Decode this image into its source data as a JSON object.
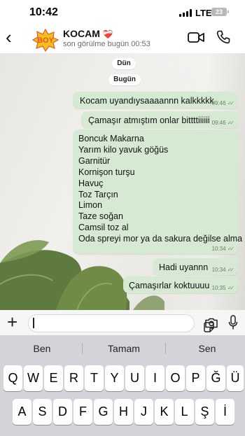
{
  "status_bar": {
    "time": "10:42",
    "network": "LTE",
    "battery": "23"
  },
  "header": {
    "back_icon": "chevron-left-icon",
    "avatar_text": "BOY",
    "contact_name": "KOCAM",
    "contact_emoji": "❤️‍🩹",
    "last_seen": "son görülme bugün 00:53",
    "video_icon": "video-camera-icon",
    "phone_icon": "phone-icon"
  },
  "chat": {
    "date_chips": [
      "Dün",
      "Bugün"
    ],
    "messages": [
      {
        "text": "Kocam uyandıysaaaannn kalkkkkk",
        "time": "09:46"
      },
      {
        "text": "Çamaşır atmıştım onlar bittttiiiiii",
        "time": "09:46"
      },
      {
        "lines": [
          "Boncuk Makarna",
          "Yarım kilo yavuk göğüs",
          "Garnitür",
          "Kornişon turşu",
          "Havuç",
          "Toz Tarçın",
          "Limon",
          "Taze soğan",
          "Camsil toz al",
          "Oda spreyi mor ya da sakura değilse alma"
        ],
        "time": "10:34"
      },
      {
        "text": "Hadi uyannn",
        "time": "10:34"
      },
      {
        "text": "Çamaşırlar koktuuuu",
        "time": "10:35"
      }
    ],
    "bubble_color": "#d6ead3"
  },
  "input": {
    "value": "",
    "plus_icon": "plus-icon",
    "sticker_icon": "sticker-icon",
    "camera_icon": "camera-icon",
    "mic_icon": "microphone-icon"
  },
  "keyboard": {
    "suggestions": [
      "Ben",
      "Tamam",
      "Sen"
    ],
    "row1": [
      "Q",
      "W",
      "E",
      "R",
      "T",
      "Y",
      "U",
      "I",
      "O",
      "P",
      "Ğ",
      "Ü"
    ],
    "row2": [
      "A",
      "S",
      "D",
      "F",
      "G",
      "H",
      "J",
      "K",
      "L",
      "Ş",
      "İ"
    ]
  }
}
